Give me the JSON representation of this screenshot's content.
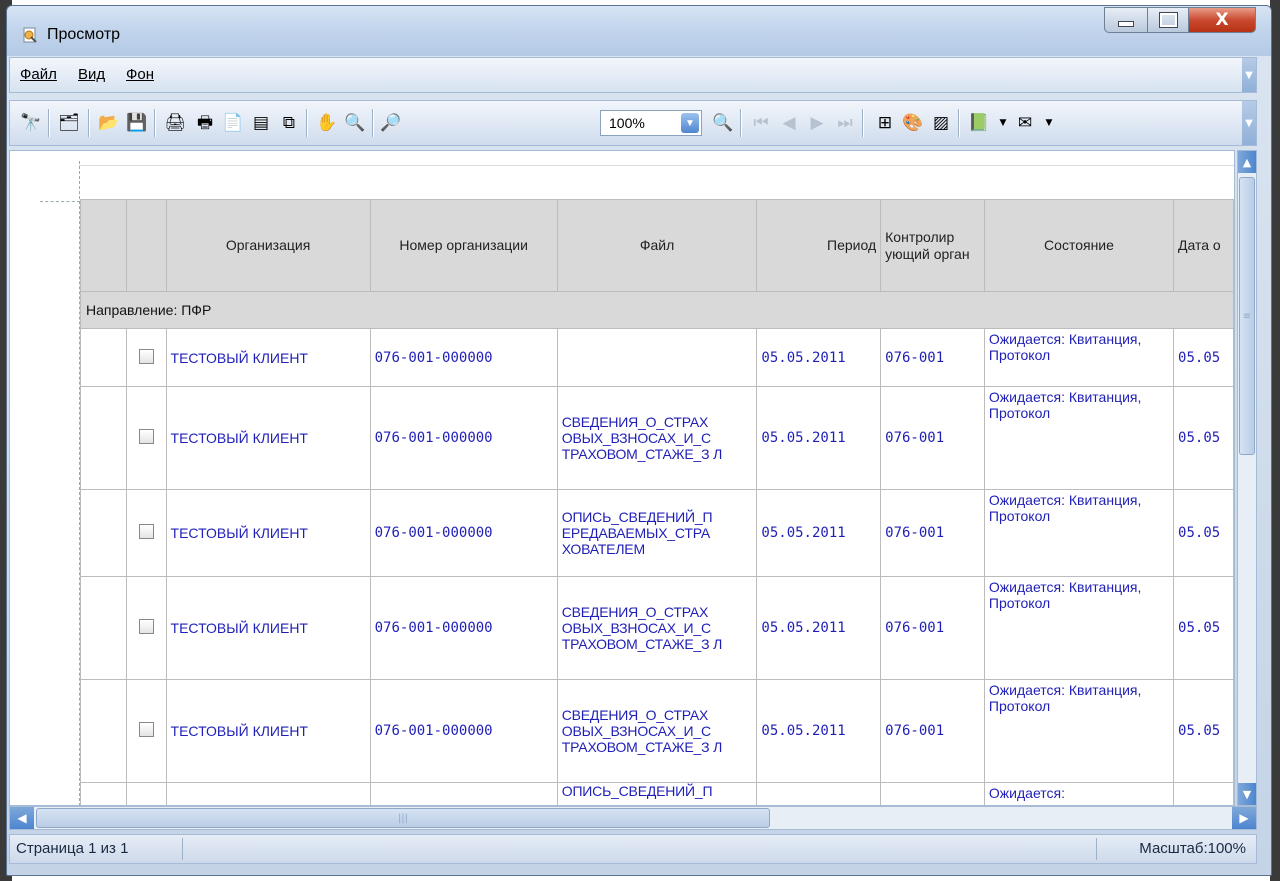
{
  "window": {
    "title": "Просмотр"
  },
  "menu": {
    "file": "Файл",
    "view": "Вид",
    "background": "Фон"
  },
  "toolbar": {
    "zoom_value": "100%",
    "icons": [
      "find-icon",
      "tree-icon",
      "open-icon",
      "save-icon",
      "page-setup-icon",
      "print-icon",
      "print-dialog-icon",
      "page-layout-icon",
      "scale-icon",
      "hand-icon",
      "magnifier-icon",
      "zoom-out-icon",
      "zoom-in-icon",
      "first-page-icon",
      "prev-page-icon",
      "next-page-icon",
      "last-page-icon",
      "multipage-icon",
      "color-icon",
      "watermark-icon",
      "export-icon",
      "email-icon"
    ]
  },
  "table": {
    "headers": {
      "organization": "Организация",
      "org_number": "Номер организации",
      "file": "Файл",
      "period": "Период",
      "control_body": "Контролир ующий орган",
      "state": "Состояние",
      "date": "Дата о"
    },
    "group_label": "Направление: ПФР",
    "rows": [
      {
        "org": "ТЕСТОВЫЙ КЛИЕНТ",
        "number": "076-001-000000",
        "file": "",
        "period": "05.05.2011",
        "body": "076-001",
        "state": "Ожидается: Квитанция, Протокол",
        "date": "05.05"
      },
      {
        "org": "ТЕСТОВЫЙ КЛИЕНТ",
        "number": "076-001-000000",
        "file": "СВЕДЕНИЯ_О_СТРАХ ОВЫХ_ВЗНОСАХ_И_С ТРАХОВОМ_СТАЖЕ_З Л",
        "period": "05.05.2011",
        "body": "076-001",
        "state": "Ожидается: Квитанция, Протокол",
        "date": "05.05"
      },
      {
        "org": "ТЕСТОВЫЙ КЛИЕНТ",
        "number": "076-001-000000",
        "file": "ОПИСЬ_СВЕДЕНИЙ_П ЕРЕДАВАЕМЫХ_СТРА ХОВАТЕЛЕМ",
        "period": "05.05.2011",
        "body": "076-001",
        "state": "Ожидается: Квитанция, Протокол",
        "date": "05.05"
      },
      {
        "org": "ТЕСТОВЫЙ КЛИЕНТ",
        "number": "076-001-000000",
        "file": "СВЕДЕНИЯ_О_СТРАХ ОВЫХ_ВЗНОСАХ_И_С ТРАХОВОМ_СТАЖЕ_З Л",
        "period": "05.05.2011",
        "body": "076-001",
        "state": "Ожидается: Квитанция, Протокол",
        "date": "05.05"
      },
      {
        "org": "ТЕСТОВЫЙ КЛИЕНТ",
        "number": "076-001-000000",
        "file": "СВЕДЕНИЯ_О_СТРАХ ОВЫХ_ВЗНОСАХ_И_С ТРАХОВОМ_СТАЖЕ_З Л",
        "period": "05.05.2011",
        "body": "076-001",
        "state": "Ожидается: Квитанция, Протокол",
        "date": "05.05"
      },
      {
        "org": "",
        "number": "",
        "file": "ОПИСЬ_СВЕДЕНИЙ_П",
        "period": "",
        "body": "",
        "state": "Ожидается:",
        "date": ""
      }
    ]
  },
  "status": {
    "page": "Страница 1 из 1",
    "scale": "Масштаб:100%"
  }
}
